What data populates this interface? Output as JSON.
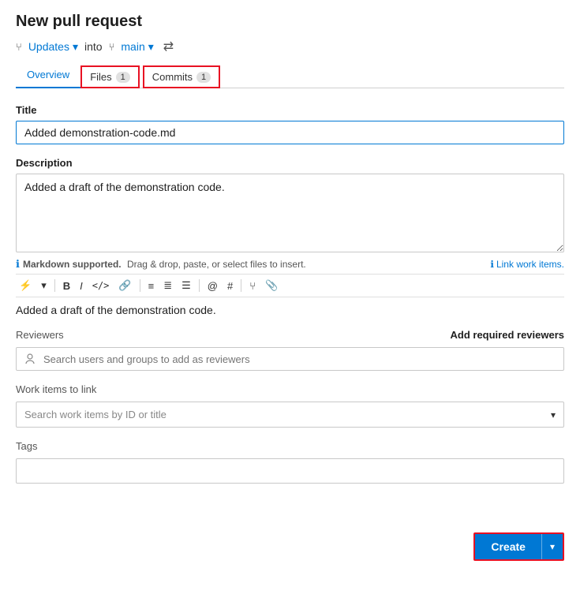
{
  "page": {
    "title": "New pull request"
  },
  "branch_row": {
    "icon": "⑂",
    "source": "Updates",
    "into_text": "into",
    "target_icon": "⑂",
    "target": "main",
    "swap_icon": "⇄"
  },
  "tabs": {
    "overview": {
      "label": "Overview"
    },
    "files": {
      "label": "Files",
      "badge": "1"
    },
    "commits": {
      "label": "Commits",
      "badge": "1"
    }
  },
  "form": {
    "title_label": "Title",
    "title_value": "Added demonstration-code.md",
    "description_label": "Description",
    "description_value": "Added a draft of the demonstration code.",
    "markdown_hint": "Markdown supported.",
    "drag_drop_hint": "Drag & drop, paste, or select files to insert.",
    "link_work_items": "Link work items.",
    "preview_text": "Added a draft of the demonstration code.",
    "reviewers_label": "Reviewers",
    "add_reviewers_label": "Add required reviewers",
    "reviewers_placeholder": "Search users and groups to add as reviewers",
    "work_items_label": "Work items to link",
    "work_items_placeholder": "Search work items by ID or title",
    "tags_label": "Tags",
    "tags_value": ""
  },
  "toolbar": {
    "buttons": [
      {
        "name": "lightning-icon",
        "symbol": "⚡"
      },
      {
        "name": "chevron-down-small-icon",
        "symbol": "˅"
      },
      {
        "name": "bold-icon",
        "symbol": "B"
      },
      {
        "name": "italic-icon",
        "symbol": "I"
      },
      {
        "name": "code-icon",
        "symbol": "</>"
      },
      {
        "name": "link-icon",
        "symbol": "🔗"
      },
      {
        "name": "ordered-list-icon",
        "symbol": "≡"
      },
      {
        "name": "unordered-list-icon",
        "symbol": "≣"
      },
      {
        "name": "task-list-icon",
        "symbol": "☰"
      },
      {
        "name": "mention-icon",
        "symbol": "@"
      },
      {
        "name": "heading-icon",
        "symbol": "#"
      },
      {
        "name": "pr-icon",
        "symbol": "⎇"
      },
      {
        "name": "attachment-icon",
        "symbol": "📎"
      }
    ]
  },
  "footer": {
    "create_label": "Create",
    "dropdown_label": "▾"
  }
}
